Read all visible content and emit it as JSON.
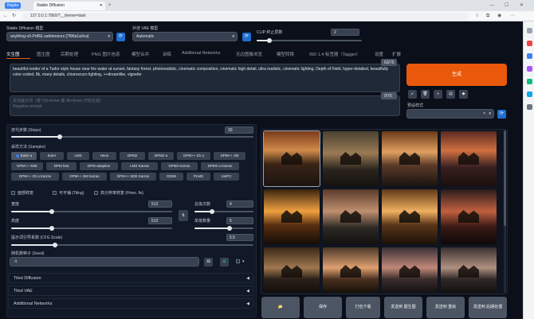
{
  "browser": {
    "tab_pill": "Rejsta",
    "tab_title": "Stable Diffusion",
    "url": "127.0.0.1:7860/?__theme=dark"
  },
  "top": {
    "model_label": "Stable Diffusion 模型",
    "model_value": "anything-v5-PrtRE.safetensors [7f96a1a9ca]",
    "vae_label": "外挂 VAE 模型",
    "vae_value": "Automatic",
    "clip_label": "CLIP 终止层数",
    "clip_value": "2",
    "clip_fraction": 0.12
  },
  "tabs": [
    "文生图",
    "图生图",
    "后期处理",
    "PNG 图片信息",
    "模型合并",
    "训练",
    "Additional Networks",
    "无边图像浏览",
    "模型转换",
    "WD 1.4 标签器（Tagger）",
    "设置",
    "扩展"
  ],
  "prompt": {
    "text": "beautiful render of a Tudor style house near the water at sunset, fantasy forest. photorealistic, cinematic composition, cinematic high detail, ultra realistic, cinematic lighting, Depth of Field, hyper-detailed, beautifully color-coded, 8k, many details, chiaroscuro lighting, ++dreamlike, vignette",
    "counter": "63/75",
    "neg_placeholder": "反向提示词（按 Ctrl+Enter 或 Alt+Enter 开始生成）\nNegative prompt",
    "neg_counter": "0/75"
  },
  "generate": {
    "label": "生成",
    "style_label": "预设样式"
  },
  "sampling": {
    "steps_label": "迭代步数 (Steps)",
    "steps_value": "30",
    "steps_fraction": 0.2,
    "method_label": "采样方法 (Sampler)",
    "samplers": [
      "Euler a",
      "Euler",
      "LMS",
      "Heun",
      "DPM2",
      "DPM2 a",
      "DPM++ 2S a",
      "DPM++ 2M",
      "DPM++ SDE",
      "DPM fast",
      "DPM adaptive",
      "LMS Karras",
      "DPM2 Karras",
      "DPM2 a Karras",
      "DPM++ 2S a Karras",
      "DPM++ 2M Karras",
      "DPM++ SDE Karras",
      "DDIM",
      "PLMS",
      "UniPC"
    ],
    "selected": "Euler a"
  },
  "options": {
    "face": "面部修复",
    "tiling": "可平铺 (Tiling)",
    "hires": "高分辨率修复 (Hires. fix)"
  },
  "dims": {
    "width_label": "宽度",
    "width_value": "512",
    "width_fraction": 0.25,
    "height_label": "高度",
    "height_value": "512",
    "height_fraction": 0.25,
    "batch_count_label": "总批次数",
    "batch_count_value": "4",
    "batch_count_fraction": 0.3,
    "batch_size_label": "单批数量",
    "batch_size_value": "5",
    "batch_size_fraction": 0.6
  },
  "cfg": {
    "label": "提示词引导系数 (CFG Scale)",
    "value": "5.5",
    "fraction": 0.18
  },
  "seed": {
    "label": "随机数种子 (Seed)",
    "value": "-1"
  },
  "accordions": [
    "Tiled Diffusion",
    "Tiled VAE",
    "Additional Networks"
  ],
  "output_buttons": [
    "📁",
    "保存",
    "打包下载",
    "发送到 图生图",
    "发送到 重绘",
    "发送到 后期处理"
  ],
  "colors": {
    "generate": "#ea580c",
    "accent_blue": "#1f6fd1",
    "bg": "#0b0f19"
  }
}
